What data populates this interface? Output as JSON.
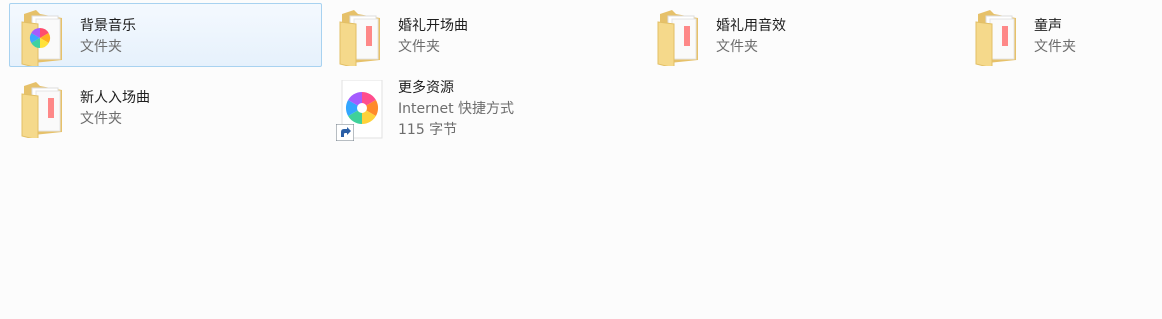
{
  "items": [
    {
      "name": "背景音乐",
      "type": "文件夹",
      "selected": true,
      "icon": "folder-icon"
    },
    {
      "name": "婚礼开场曲",
      "type": "文件夹",
      "icon": "folder-icon"
    },
    {
      "name": "婚礼用音效",
      "type": "文件夹",
      "icon": "folder-icon"
    },
    {
      "name": "童声",
      "type": "文件夹",
      "icon": "folder-icon"
    },
    {
      "name": "新人入场曲",
      "type": "文件夹",
      "icon": "folder-icon"
    },
    {
      "name": "更多资源",
      "type": "Internet 快捷方式",
      "size": "115 字节",
      "icon": "internet-shortcut-icon"
    }
  ],
  "colors": {
    "selection_border": "#a8d2f0",
    "selection_fill": "#e6f1fc",
    "folder": "#f2d27b"
  }
}
